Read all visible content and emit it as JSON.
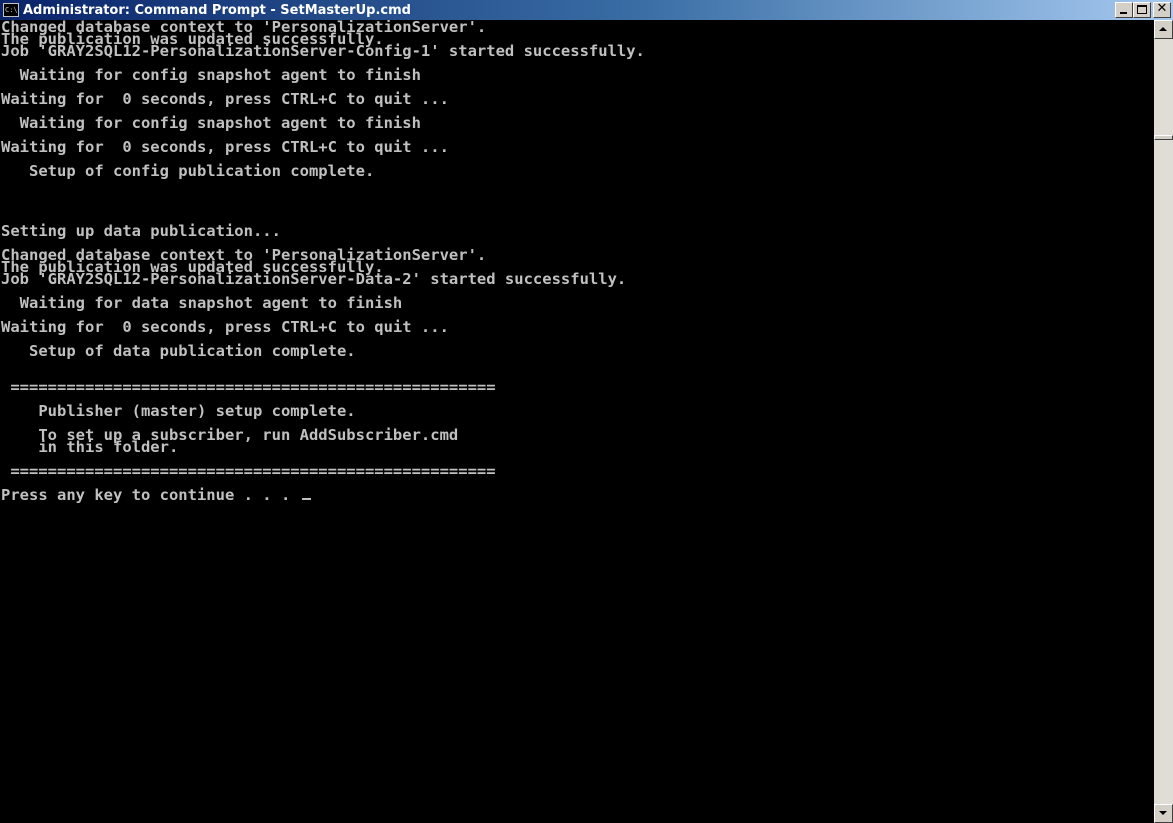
{
  "window": {
    "title": "Administrator: Command Prompt - SetMasterUp.cmd",
    "icon": "cmd-icon",
    "buttons": {
      "minimize": "minimize-icon",
      "maximize": "maximize-icon",
      "close": "close-icon"
    }
  },
  "console": {
    "foreground": "#c0c0c0",
    "background": "#000000",
    "lines": [
      "Changed database context to 'PersonalizationServer'.",
      "The publication was updated successfully.",
      "Job 'GRAY2SQL12-PersonalizationServer-Config-1' started successfully.",
      "",
      "  Waiting for config snapshot agent to finish",
      "",
      "Waiting for  0 seconds, press CTRL+C to quit ...",
      "",
      "  Waiting for config snapshot agent to finish",
      "",
      "Waiting for  0 seconds, press CTRL+C to quit ...",
      "",
      "   Setup of config publication complete.",
      "",
      "",
      "",
      "",
      "Setting up data publication...",
      "",
      "Changed database context to 'PersonalizationServer'.",
      "The publication was updated successfully.",
      "Job 'GRAY2SQL12-PersonalizationServer-Data-2' started successfully.",
      "",
      "  Waiting for data snapshot agent to finish",
      "",
      "Waiting for  0 seconds, press CTRL+C to quit ...",
      "",
      "   Setup of data publication complete.",
      "",
      "",
      " ====================================================",
      "",
      "    Publisher (master) setup complete.",
      "",
      "    To set up a subscriber, run AddSubscriber.cmd",
      "    in this folder.",
      "",
      " ====================================================",
      "",
      "Press any key to continue . . . "
    ]
  },
  "scrollbar": {
    "up": "scroll-up-arrow-icon",
    "down": "scroll-down-arrow-icon"
  }
}
